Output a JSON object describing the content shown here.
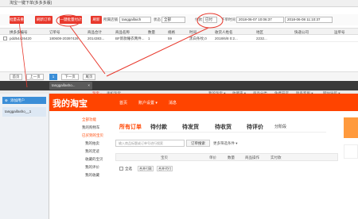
{
  "window": {
    "title": "淘宝一键下单(多多多版)"
  },
  "toolbar": {
    "buttons": [
      "批量去重",
      "刷新订单",
      "一键批量付款",
      "刷新"
    ],
    "shop_label": "所属店铺",
    "shop_value": "tanggaifaich",
    "status_label": "状态",
    "status_value": "全部",
    "type_label": "付款",
    "type_value": "已付",
    "time_label": "下单时间",
    "time_from": "2018-06-07 10:06:37",
    "time_to": "2018-06-08 11:10:37"
  },
  "table": {
    "headers": [
      "",
      "拼多多编号",
      "订单号",
      "商品合计",
      "商品名称",
      "数量",
      "规格",
      "时间",
      "收货人姓名",
      "地区",
      "快递公司",
      "运单号"
    ],
    "rows": [
      [
        "",
        "pdd54426420",
        "180608-20397426",
        "2014383...",
        "BF新款睡衣两件...",
        "1",
        "59",
        "黑白条纹,0",
        "2018/6/8 0:2...",
        "2232...",
        "",
        ""
      ]
    ]
  },
  "pager": {
    "first": "首页",
    "prev": "上一页",
    "page": "1",
    "next": "下一页",
    "last": "尾页"
  },
  "browser": {
    "tab_label": "tanggaifasho...",
    "tab_close": "×",
    "addr_site": "淘宝 ·",
    "addr_text": "手机淘宝",
    "top_links": [
      "我的淘宝 ▾",
      "收藏夹 ▾",
      "商品分类",
      "免费开店",
      "联系客服 ▾",
      "网站导航 ▾"
    ],
    "left_panel": {
      "add_user": "添加用户",
      "user": "tanggaifasho__1"
    },
    "header": {
      "logo": "我的淘宝",
      "nav": [
        "首页",
        "账户设置 ▾",
        "消息"
      ]
    },
    "side": {
      "title": "全部功能",
      "items": [
        "我的购物车",
        "已买到的宝贝",
        "我的拍卖",
        "我的足迹",
        "收藏的宝贝",
        "我的评价",
        "我的收藏"
      ]
    },
    "tabs": [
      "所有订单",
      "待付款",
      "待发货",
      "待收货",
      "待评价",
      "分阶段"
    ],
    "tab_counts": [
      "",
      "",
      "",
      "",
      "",
      ""
    ],
    "search_placeholder": "输入商品标题或订单号进行搜索",
    "search_button": "订单搜索",
    "more_filter": "更多筛选条件 ▾",
    "list_headers": [
      "宝贝",
      "单价",
      "数量",
      "商品操作",
      "实付款"
    ],
    "select_all": "全选",
    "batch_confirm": "合并付款",
    "batch_receipt": "合并代付"
  },
  "colors": {
    "accent": "#ff4400",
    "highlight": "#e8382c",
    "blue": "#3b8ed7"
  }
}
